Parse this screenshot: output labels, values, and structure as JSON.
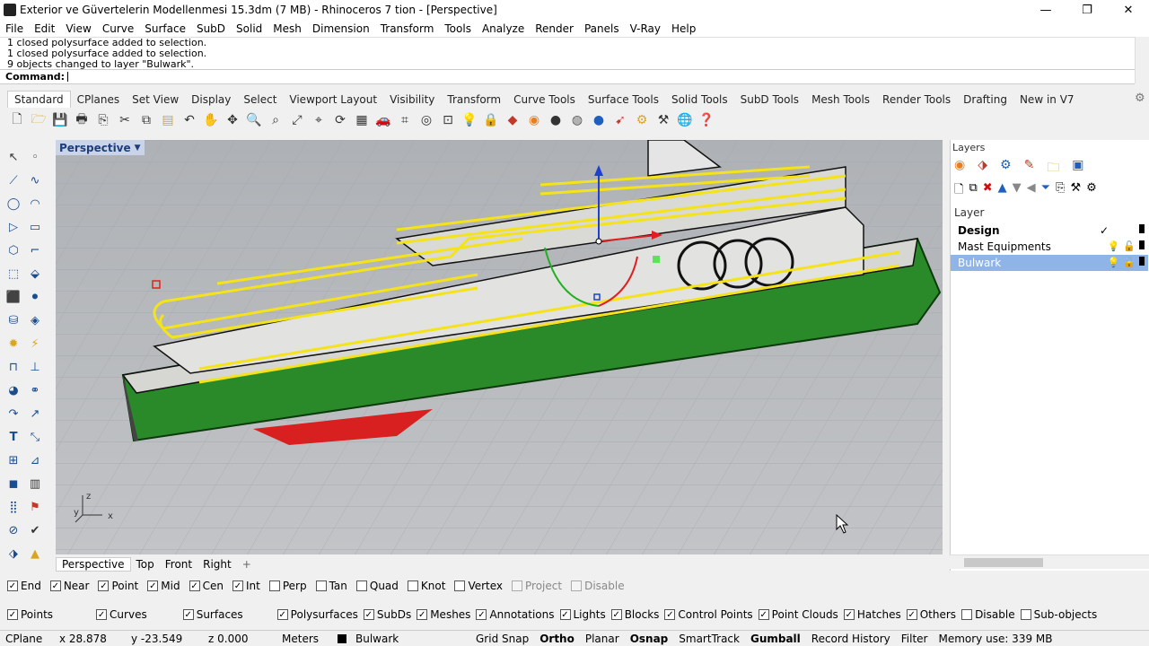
{
  "window": {
    "title": "Exterior ve Güvertelerin Modellenmesi 15.3dm (7 MB) - Rhinoceros 7 tion - [Perspective]",
    "min": "—",
    "max": "❐",
    "close": "✕"
  },
  "menu": [
    "File",
    "Edit",
    "View",
    "Curve",
    "Surface",
    "SubD",
    "Solid",
    "Mesh",
    "Dimension",
    "Transform",
    "Tools",
    "Analyze",
    "Render",
    "Panels",
    "V-Ray",
    "Help"
  ],
  "command": {
    "history": [
      "1 closed polysurface added to selection.",
      "1 closed polysurface added to selection.",
      "9 objects changed to layer \"Bulwark\"."
    ],
    "label": "Command:",
    "value": ""
  },
  "toolbar_tabs": [
    "Standard",
    "CPlanes",
    "Set View",
    "Display",
    "Select",
    "Viewport Layout",
    "Visibility",
    "Transform",
    "Curve Tools",
    "Surface Tools",
    "Solid Tools",
    "SubD Tools",
    "Mesh Tools",
    "Render Tools",
    "Drafting",
    "New in V7"
  ],
  "toolbar_icons": [
    "new-icon",
    "open-icon",
    "save-icon",
    "print-icon",
    "import-icon",
    "cut-icon",
    "copy-icon",
    "paste-icon",
    "undo-icon",
    "pan-icon",
    "move-icon",
    "zoom-icon",
    "zoom-window-icon",
    "zoom-extents-icon",
    "zoom-selected-icon",
    "rotate-icon",
    "viewport-layout-icon",
    "car-icon",
    "grid-icon",
    "target-icon",
    "named-view-icon",
    "light-icon",
    "lock-icon",
    "shade-icon",
    "color-icon",
    "render-icon",
    "material-icon",
    "sphere-icon",
    "pointer-icon",
    "gear-icon",
    "options-icon",
    "globe-icon",
    "help-icon"
  ],
  "viewport": {
    "label": "Perspective",
    "axis_z": "z",
    "axis_x": "x",
    "axis_y": "y"
  },
  "viewport_tabs": [
    "Perspective",
    "Top",
    "Front",
    "Right"
  ],
  "viewport_tab_add": "+",
  "layers": {
    "title": "Layers",
    "column": "Layer",
    "rows": [
      {
        "name": "Design",
        "current": "✓"
      },
      {
        "name": "Mast Equipments"
      },
      {
        "name": "Bulwark"
      }
    ]
  },
  "osnap": [
    {
      "label": "End",
      "checked": true
    },
    {
      "label": "Near",
      "checked": true
    },
    {
      "label": "Point",
      "checked": true
    },
    {
      "label": "Mid",
      "checked": true
    },
    {
      "label": "Cen",
      "checked": true
    },
    {
      "label": "Int",
      "checked": true
    },
    {
      "label": "Perp",
      "checked": false
    },
    {
      "label": "Tan",
      "checked": false
    },
    {
      "label": "Quad",
      "checked": false
    },
    {
      "label": "Knot",
      "checked": false
    },
    {
      "label": "Vertex",
      "checked": false
    },
    {
      "label": "Project",
      "checked": false,
      "disabled": true
    },
    {
      "label": "Disable",
      "checked": false,
      "disabled": true
    }
  ],
  "filters": [
    {
      "label": "Points",
      "checked": true
    },
    {
      "label": "Curves",
      "checked": true
    },
    {
      "label": "Surfaces",
      "checked": true
    },
    {
      "label": "Polysurfaces",
      "checked": true
    },
    {
      "label": "SubDs",
      "checked": true
    },
    {
      "label": "Meshes",
      "checked": true
    },
    {
      "label": "Annotations",
      "checked": true
    },
    {
      "label": "Lights",
      "checked": true
    },
    {
      "label": "Blocks",
      "checked": true
    },
    {
      "label": "Control Points",
      "checked": true
    },
    {
      "label": "Point Clouds",
      "checked": true
    },
    {
      "label": "Hatches",
      "checked": true
    },
    {
      "label": "Others",
      "checked": true
    },
    {
      "label": "Disable",
      "checked": false
    },
    {
      "label": "Sub-objects",
      "checked": false
    }
  ],
  "status": {
    "cplane": "CPlane",
    "x": "x 28.878",
    "y": "y -23.549",
    "z": "z 0.000",
    "units": "Meters",
    "layer": "Bulwark",
    "grid_snap": "Grid Snap",
    "ortho": "Ortho",
    "planar": "Planar",
    "osnap": "Osnap",
    "smarttrack": "SmartTrack",
    "gumball": "Gumball",
    "record_history": "Record History",
    "filter": "Filter",
    "memory": "Memory use: 339 MB"
  }
}
